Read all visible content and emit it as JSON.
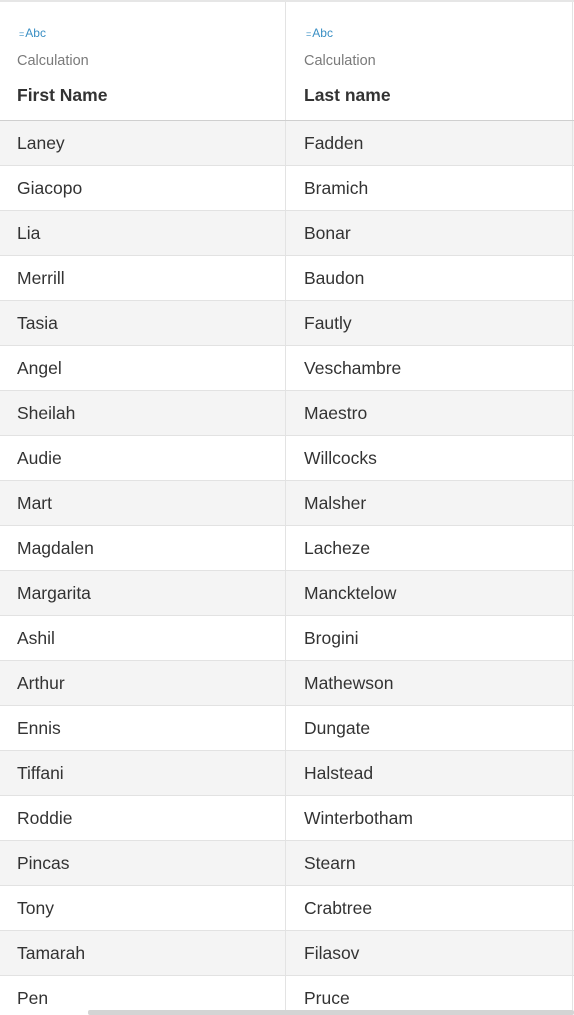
{
  "columns": [
    {
      "type_icon": "Abc",
      "type_label": "Calculation",
      "title": "First Name"
    },
    {
      "type_icon": "Abc",
      "type_label": "Calculation",
      "title": "Last name"
    }
  ],
  "rows": [
    {
      "first": "Laney",
      "last": "Fadden"
    },
    {
      "first": "Giacopo",
      "last": "Bramich"
    },
    {
      "first": "Lia",
      "last": "Bonar"
    },
    {
      "first": "Merrill",
      "last": "Baudon"
    },
    {
      "first": "Tasia",
      "last": "Fautly"
    },
    {
      "first": "Angel",
      "last": "Veschambre"
    },
    {
      "first": "Sheilah",
      "last": "Maestro"
    },
    {
      "first": "Audie",
      "last": "Willcocks"
    },
    {
      "first": "Mart",
      "last": "Malsher"
    },
    {
      "first": "Magdalen",
      "last": "Lacheze"
    },
    {
      "first": "Margarita",
      "last": "Mancktelow"
    },
    {
      "first": "Ashil",
      "last": "Brogini"
    },
    {
      "first": "Arthur",
      "last": "Mathewson"
    },
    {
      "first": "Ennis",
      "last": "Dungate"
    },
    {
      "first": "Tiffani",
      "last": "Halstead"
    },
    {
      "first": "Roddie",
      "last": "Winterbotham"
    },
    {
      "first": "Pincas",
      "last": "Stearn"
    },
    {
      "first": "Tony",
      "last": "Crabtree"
    },
    {
      "first": "Tamarah",
      "last": "Filasov"
    },
    {
      "first": "Pen",
      "last": "Pruce"
    }
  ],
  "colors": {
    "accent": "#3a8fc4",
    "row_shade": "#f4f4f4",
    "text": "#333333",
    "muted": "#7a7a7a"
  }
}
